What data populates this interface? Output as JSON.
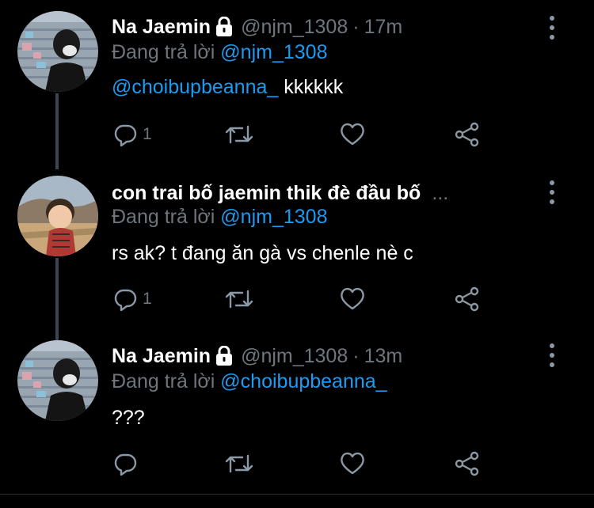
{
  "colors": {
    "link": "#1d9bf0",
    "secondary": "#6e767d",
    "background": "#000000"
  },
  "tweets": [
    {
      "name": "Na Jaemin",
      "protected_icon": "lock-icon",
      "handle": "@njm_1308",
      "separator": "·",
      "time": "17m",
      "reply_prefix": "Đang trả lời",
      "reply_to": "@njm_1308",
      "mention": "@choibupbeanna_",
      "text": " kkkkkk",
      "replies": "1"
    },
    {
      "name": "con trai bố jaemin thik đè đầu bố",
      "name_overflow": "...",
      "reply_prefix": "Đang trả lời",
      "reply_to": "@njm_1308",
      "mention": "",
      "text": "rs ak? t đang ăn gà vs chenle nè c",
      "replies": "1"
    },
    {
      "name": "Na Jaemin",
      "protected_icon": "lock-icon",
      "handle": "@njm_1308",
      "separator": "·",
      "time": "13m",
      "reply_prefix": "Đang trả lời",
      "reply_to": "@choibupbeanna_",
      "mention": "",
      "text": "???",
      "replies": ""
    }
  ]
}
